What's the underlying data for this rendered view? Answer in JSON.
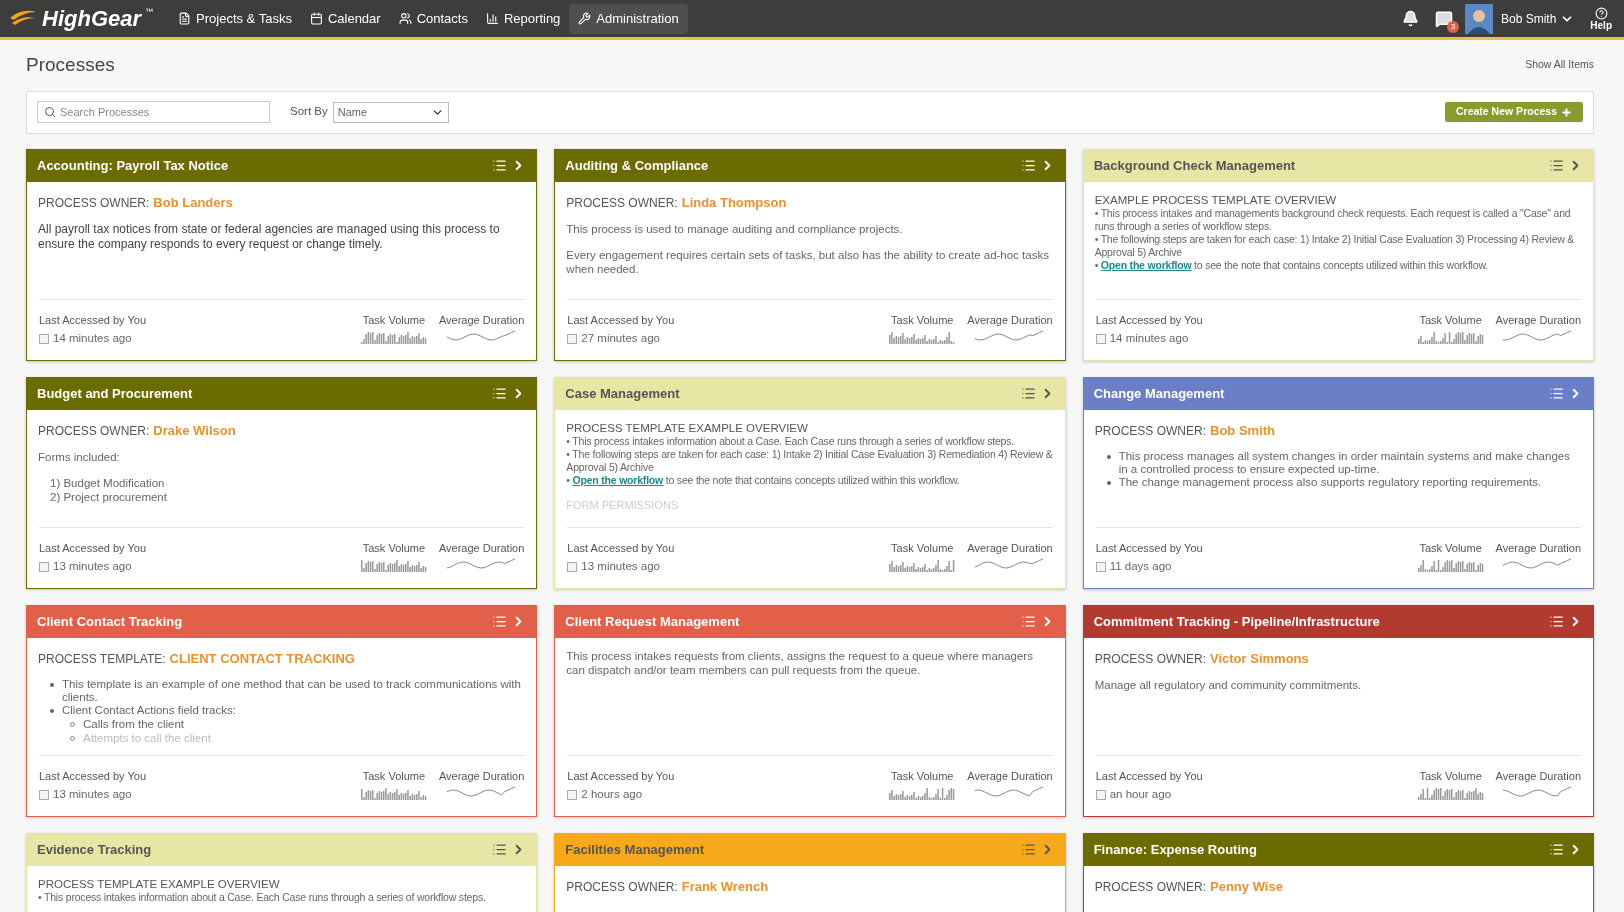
{
  "nav": {
    "logo": "HighGear",
    "logo_mark": "™",
    "items": [
      {
        "label": "Projects & Tasks",
        "selected": false
      },
      {
        "label": "Calendar",
        "selected": false
      },
      {
        "label": "Contacts",
        "selected": false
      },
      {
        "label": "Reporting",
        "selected": false
      },
      {
        "label": "Administration",
        "selected": true
      }
    ],
    "chat_badge": "3",
    "user": "Bob Smith",
    "help": "Help"
  },
  "page": {
    "title": "Processes",
    "show_all": "Show All Items"
  },
  "filters": {
    "search_placeholder": "Search Processes",
    "sort_label": "Sort By",
    "sort_value": "Name",
    "create_button": "Create New Process"
  },
  "cards": [
    {
      "title": "Accounting: Payroll Tax Notice",
      "color": "#6b6b00",
      "footer": {
        "label": "Last Accessed by You",
        "time": "14 minutes ago",
        "task_volume": "Task Volume",
        "average_duration": "Average Duration"
      },
      "blocks": [
        {
          "kind": "owner",
          "label": "PROCESS OWNER:",
          "value": "Bob Landers"
        },
        {
          "kind": "lead",
          "text": "All payroll tax notices from state or federal agencies are managed using this process to ensure the company responds to every request or change timely."
        }
      ]
    },
    {
      "title": "Auditing & Compliance",
      "color": "#6b6b00",
      "footer": {
        "label": "Last Accessed by You",
        "time": "27 minutes ago",
        "task_volume": "Task Volume",
        "average_duration": "Average Duration"
      },
      "blocks": [
        {
          "kind": "owner",
          "label": "PROCESS OWNER:",
          "value": "Linda Thompson"
        },
        {
          "kind": "text",
          "text": "This process is used to manage auditing and compliance projects."
        },
        {
          "kind": "text",
          "text": "Every engagement requires certain sets of tasks, but also has the ability to create ad-hoc tasks when needed."
        }
      ]
    },
    {
      "title": "Background Check Management",
      "color": "#e8e6a4",
      "footer": {
        "label": "Last Accessed by You",
        "time": "14 minutes ago",
        "task_volume": "Task Volume",
        "average_duration": "Average Duration"
      },
      "blocks": [
        {
          "kind": "heading",
          "text": "EXAMPLE PROCESS TEMPLATE OVERVIEW"
        },
        {
          "kind": "line",
          "text": "• This process intakes and managements background check requests. Each request is called a \"Case\" and runs through a series of workflow steps."
        },
        {
          "kind": "line",
          "text": "• The following steps are taken for each case: 1) Intake 2) Initial Case Evaluation 3) Processing 4) Review & Approval 5) Archive"
        },
        {
          "kind": "link",
          "bullet": "•",
          "link": "Open the workflow",
          "text": "to see the note that contains concepts utilized within this workflow."
        }
      ]
    },
    {
      "title": "Budget and Procurement",
      "color": "#6b6b00",
      "footer": {
        "label": "Last Accessed by You",
        "time": "13 minutes ago",
        "task_volume": "Task Volume",
        "average_duration": "Average Duration"
      },
      "blocks": [
        {
          "kind": "owner",
          "label": "PROCESS OWNER:",
          "value": "Drake Wilson"
        },
        {
          "kind": "text",
          "text": "Forms included:"
        },
        {
          "kind": "item",
          "text": "1) Budget Modification"
        },
        {
          "kind": "item",
          "text": "2) Project procurement"
        }
      ]
    },
    {
      "title": "Case Management",
      "color": "#e8e6a4",
      "footer": {
        "label": "Last Accessed by You",
        "time": "13 minutes ago",
        "task_volume": "Task Volume",
        "average_duration": "Average Duration"
      },
      "blocks": [
        {
          "kind": "heading",
          "text": "PROCESS TEMPLATE EXAMPLE OVERVIEW"
        },
        {
          "kind": "line",
          "text": "• This process intakes information about a Case. Each Case runs through a series of workflow steps."
        },
        {
          "kind": "line",
          "text": "• The following steps are taken for each case: 1) Intake 2) Initial Case Evaluation 3) Remediation 4) Review & Approval 5) Archive"
        },
        {
          "kind": "link",
          "bullet": "•",
          "link": "Open the workflow",
          "text": "to see the note that contains concepts utilized within this workflow."
        },
        {
          "kind": "faded",
          "text": "FORM PERMISSIONS"
        }
      ]
    },
    {
      "title": "Change Management",
      "color": "#6a7fc6",
      "footer": {
        "label": "Last Accessed by You",
        "time": "11 days ago",
        "task_volume": "Task Volume",
        "average_duration": "Average Duration"
      },
      "blocks": [
        {
          "kind": "owner",
          "label": "PROCESS OWNER:",
          "value": "Bob Smith"
        },
        {
          "kind": "bullets",
          "items": [
            {
              "text": "This process manages all system changes in order maintain systems and make changes in a controlled process to ensure expected up-time."
            },
            {
              "text": "The change management process also supports regulatory reporting requirements."
            }
          ]
        }
      ]
    },
    {
      "title": "Client Contact Tracking",
      "color": "#e2604a",
      "footer": {
        "label": "Last Accessed by You",
        "time": "13 minutes ago",
        "task_volume": "Task Volume",
        "average_duration": "Average Duration"
      },
      "blocks": [
        {
          "kind": "owner",
          "label": "PROCESS TEMPLATE:",
          "value": "CLIENT CONTACT TRACKING"
        },
        {
          "kind": "bullets",
          "items": [
            {
              "text": "This template is an example of one method that can be used to track communications with clients."
            },
            {
              "text": "Client Contact Actions field tracks:",
              "children": [
                {
                  "text": "Calls from the client",
                  "faded": false
                },
                {
                  "text": "Attempts to call the client",
                  "faded": true
                }
              ]
            }
          ]
        }
      ]
    },
    {
      "title": "Client Request Management",
      "color": "#e2604a",
      "footer": {
        "label": "Last Accessed by You",
        "time": "2 hours ago",
        "task_volume": "Task Volume",
        "average_duration": "Average Duration"
      },
      "blocks": [
        {
          "kind": "text",
          "text": "This process intakes requests from clients, assigns the request to a queue where managers can dispatch and/or team members can pull requests from the queue."
        }
      ]
    },
    {
      "title": "Commitment Tracking - Pipeline/Infrastructure",
      "color": "#b23b2f",
      "footer": {
        "label": "Last Accessed by You",
        "time": "an hour ago",
        "task_volume": "Task Volume",
        "average_duration": "Average Duration"
      },
      "blocks": [
        {
          "kind": "owner",
          "label": "PROCESS OWNER:",
          "value": "Victor Simmons"
        },
        {
          "kind": "text",
          "text": "Manage all regulatory and community commitments."
        }
      ]
    },
    {
      "title": "Evidence Tracking",
      "color": "#e8e6a4",
      "blocks": [
        {
          "kind": "heading",
          "text": "PROCESS TEMPLATE EXAMPLE OVERVIEW"
        },
        {
          "kind": "line",
          "text": "• This process intakes information about a Case. Each Case runs through a series of workflow steps."
        }
      ]
    },
    {
      "title": "Facilities Management",
      "color": "#f7a81b",
      "blocks": [
        {
          "kind": "owner",
          "label": "PROCESS OWNER:",
          "value": "Frank Wrench"
        }
      ]
    },
    {
      "title": "Finance: Expense Routing",
      "color": "#6b6b00",
      "blocks": [
        {
          "kind": "owner",
          "label": "PROCESS OWNER:",
          "value": "Penny Wise"
        }
      ]
    }
  ]
}
